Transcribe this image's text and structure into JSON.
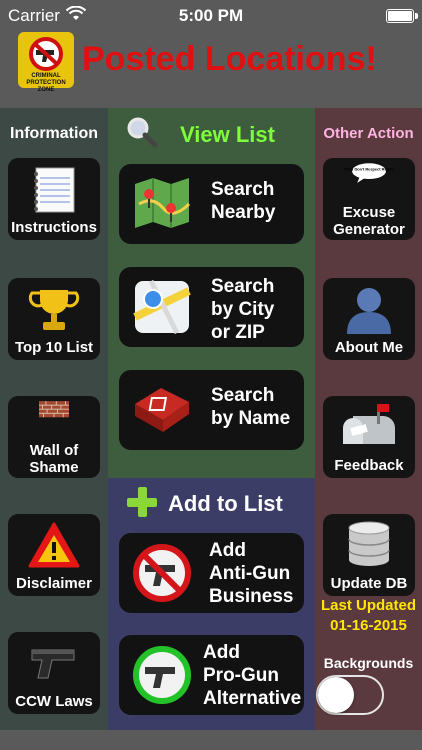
{
  "status_bar": {
    "carrier": "Carrier",
    "time": "5:00 PM"
  },
  "header": {
    "title": "Posted Locations!",
    "logo_text": "CRIMINAL PROTECTION ZONE"
  },
  "left": {
    "heading": "Information",
    "items": [
      {
        "label": "Instructions",
        "icon": "notebook-icon"
      },
      {
        "label": "Top 10 List",
        "icon": "trophy-icon"
      },
      {
        "label": "Wall of\nShame",
        "icon": "brick-wall-icon"
      },
      {
        "label": "Disclaimer",
        "icon": "warning-icon"
      },
      {
        "label": "CCW Laws",
        "icon": "pistol-icon"
      }
    ]
  },
  "middle": {
    "view_heading": "View List",
    "add_heading": "Add to List",
    "view_buttons": [
      {
        "label": "Search\nNearby",
        "icon": "map-pins-icon"
      },
      {
        "label": "Search\nby City\nor ZIP",
        "icon": "maps-app-icon"
      },
      {
        "label": "Search\nby Name",
        "icon": "address-book-icon"
      }
    ],
    "add_buttons": [
      {
        "label": "Add\nAnti-Gun\nBusiness",
        "icon": "no-guns-icon"
      },
      {
        "label": "Add\nPro-Gun\nAlternative",
        "icon": "gun-allowed-icon"
      }
    ]
  },
  "right": {
    "heading": "Other Action",
    "items": [
      {
        "label": "Excuse\nGenerator",
        "icon": "speech-bubble-icon",
        "bubble_text": "They Don't Respect Rights"
      },
      {
        "label": "About Me",
        "icon": "person-silhouette-icon"
      },
      {
        "label": "Feedback",
        "icon": "mailbox-icon"
      },
      {
        "label": "Update DB",
        "icon": "database-icon"
      }
    ],
    "last_updated_label": "Last Updated",
    "last_updated_date": "01-16-2015",
    "backgrounds_label": "Backgrounds",
    "backgrounds_on": false
  },
  "colors": {
    "title_red": "#e01010",
    "info_head": "#ffffff",
    "view_head": "#7dff3a",
    "add_head": "#ffffff",
    "other_head": "#ffb3e0",
    "updated_yellow": "#ffe600"
  }
}
